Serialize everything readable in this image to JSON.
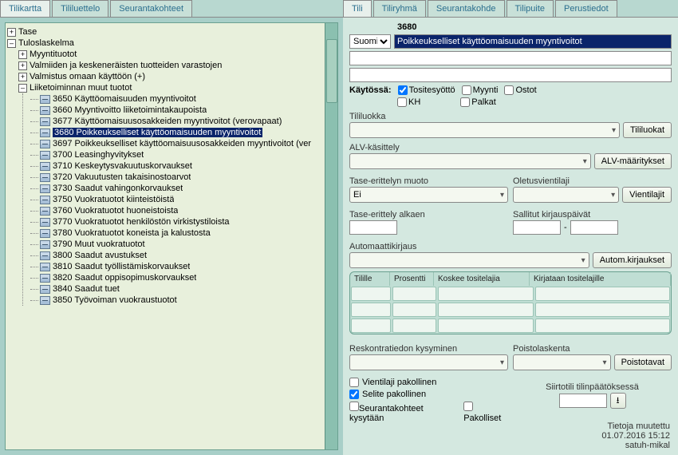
{
  "left_tabs": [
    "Tilikartta",
    "Tililuettelo",
    "Seurantakohteet"
  ],
  "right_tabs": [
    "Tili",
    "Tiliryhmä",
    "Seurantakohde",
    "Tilipuite",
    "Perustiedot"
  ],
  "tree": {
    "tase": "Tase",
    "tulos": "Tuloslaskelma",
    "myyntituotot": "Myyntituotot",
    "valmiiden": "Valmiiden ja keskeneräisten tuotteiden varastojen",
    "valmistus": "Valmistus omaan käyttöön (+)",
    "liiketoiminnan": "Liiketoiminnan muut tuotot",
    "leaves": [
      "3650 Käyttöomaisuuden myyntivoitot",
      "3660 Myyntivoitto liiketoimintakaupoista",
      "3677 Käyttöomaisuusosakkeiden myyntivoitot (verovapaat)",
      "3680 Poikkeukselliset käyttöomaisuuden myyntivoitot",
      "3697 Poikkeukselliset käyttöomaisuusosakkeiden myyntivoitot (ver",
      "3700 Leasinghyvitykset",
      "3710 Keskeytysvakuutuskorvaukset",
      "3720 Vakuutusten takaisinostoarvot",
      "3730 Saadut vahingonkorvaukset",
      "3750 Vuokratuotot kiinteistöistä",
      "3760 Vuokratuotot huoneistoista",
      "3770 Vuokratuotot henkilöstön virkistystiloista",
      "3780 Vuokratuotot koneista ja kalustosta",
      "3790 Muut vuokratuotot",
      "3800 Saadut avustukset",
      "3810 Saadut työllistämiskorvaukset",
      "3820 Saadut oppisopimuskorvaukset",
      "3840 Saadut tuet",
      "3850 Työvoiman vuokraustuotot"
    ],
    "selected_index": 3
  },
  "form": {
    "account_number": "3680",
    "lang": "Suomi",
    "description": "Poikkeukselliset käyttöomaisuuden myyntivoitot",
    "kaytossa_label": "Käytössä:",
    "checks": {
      "tositesyotto": "Tositesyöttö",
      "myynti": "Myynti",
      "ostot": "Ostot",
      "kh": "KH",
      "palkat": "Palkat"
    },
    "tililuokka_label": "Tililuokka",
    "tililuokat_btn": "Tililuokat",
    "alv_label": "ALV-käsittely",
    "alv_btn": "ALV-määritykset",
    "tase_erittelyn_label": "Tase-erittelyn muoto",
    "tase_erittelyn_value": "Ei",
    "oletusvientilaji_label": "Oletusvientilaji",
    "vientilajit_btn": "Vientilajit",
    "tase_erittely_alkaen": "Tase-erittely alkaen",
    "sallitut_kirjauspaivi": "Sallitut kirjauspäivät",
    "automaattikirjaus": "Automaattikirjaus",
    "autom_btn": "Autom.kirjaukset",
    "grid_headers": [
      "Tilille",
      "Prosentti",
      "Koskee tositelajia",
      "Kirjataan tositelajille"
    ],
    "reskontra_label": "Reskontratiedon kysyminen",
    "poistolaskenta_label": "Poistolaskenta",
    "poistotavat_btn": "Poistotavat",
    "vientilaji_pakollinen": "Vientilaji pakollinen",
    "siirtotili": "Siirtotili tilinpäätöksessä",
    "selite_pakollinen": "Selite pakollinen",
    "seurantakohteet_kysytaan": "Seurantakohteet kysytään",
    "pakolliset": "Pakolliset",
    "tietoja_muutettu": "Tietoja muutettu",
    "tietoja_date": "01.07.2016 15:12",
    "tietoja_user": "satuh-mikal"
  }
}
